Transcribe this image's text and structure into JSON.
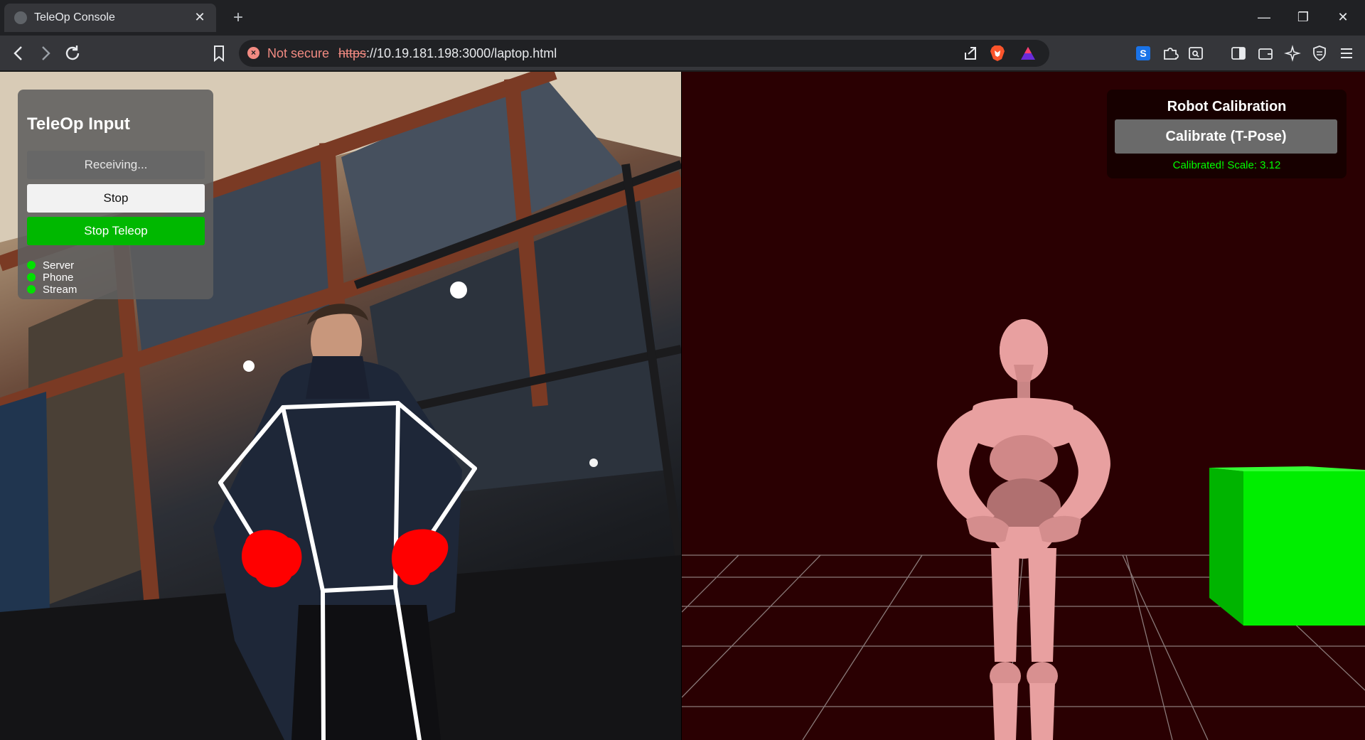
{
  "browser": {
    "tab_title": "TeleOp Console",
    "not_secure_label": "Not secure",
    "url_scheme": "https",
    "url_rest": "://10.19.181.198:3000/laptop.html"
  },
  "teleop_panel": {
    "title": "TeleOp Input",
    "status_button": "Receiving...",
    "stop_button": "Stop",
    "teleop_button": "Stop Teleop",
    "indicators": [
      {
        "label": "Server",
        "color": "#00e000"
      },
      {
        "label": "Phone",
        "color": "#00e000"
      },
      {
        "label": "Stream",
        "color": "#00e000"
      }
    ]
  },
  "calibration_panel": {
    "title": "Robot Calibration",
    "button": "Calibrate (T-Pose)",
    "status": "Calibrated! Scale: 3.12"
  },
  "colors": {
    "accent_green": "#00b800",
    "scene_bg": "#2a0002",
    "robot_skin": "#e8a0a0",
    "cube": "#00ee00",
    "skeleton": "#ffffff",
    "hand_markers": "#ff0000"
  }
}
